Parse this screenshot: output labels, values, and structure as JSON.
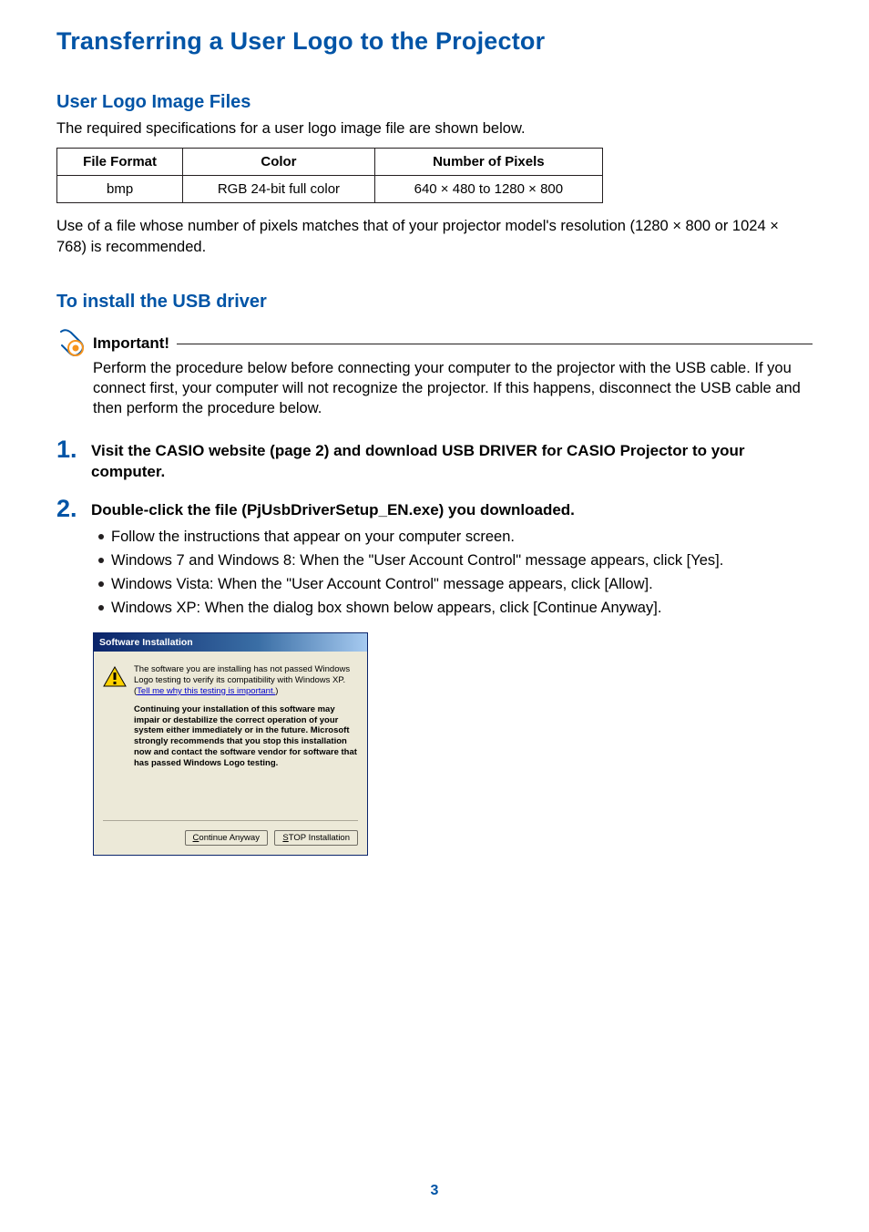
{
  "page": {
    "title": "Transferring a User Logo to the Projector",
    "number": "3"
  },
  "section1": {
    "title": "User Logo Image Files",
    "intro": "The required specifications for a user logo image file are shown below.",
    "table": {
      "headers": [
        "File Format",
        "Color",
        "Number of Pixels"
      ],
      "row": [
        "bmp",
        "RGB 24-bit full color",
        "640 × 480 to 1280 × 800"
      ]
    },
    "note": "Use of a file whose number of pixels matches that of your projector model's resolution (1280 × 800 or 1024 × 768) is recommended."
  },
  "section2": {
    "title": "To install the USB driver",
    "important": {
      "label": "Important!",
      "text": "Perform the procedure below before connecting your computer to the projector with the USB cable. If you connect first, your computer will not recognize the projector. If this happens, disconnect the USB cable and then perform the procedure below."
    },
    "steps": [
      {
        "num": "1.",
        "heading": "Visit the CASIO website (page 2) and download USB DRIVER for CASIO Projector to your computer."
      },
      {
        "num": "2.",
        "heading": "Double-click the file (PjUsbDriverSetup_EN.exe) you downloaded.",
        "bullets": [
          "Follow the instructions that appear on your computer screen.",
          "Windows 7 and Windows 8: When the \"User Account Control\" message appears, click [Yes].",
          "Windows Vista: When the \"User Account Control\" message appears, click [Allow].",
          "Windows XP: When the dialog box shown below appears, click [Continue Anyway]."
        ]
      }
    ]
  },
  "dialog": {
    "title": "Software Installation",
    "line1": "The software you are installing has not passed Windows Logo testing to verify its compatibility with Windows XP. (",
    "link": "Tell me why this testing is important.",
    "line1_end": ")",
    "bold": "Continuing your installation of this software may impair or destabilize the correct operation of your system either immediately or in the future. Microsoft strongly recommends that you stop this installation now and contact the software vendor for software that has passed Windows Logo testing.",
    "btn_continue": "Continue Anyway",
    "btn_stop_u": "S",
    "btn_stop_rest": "TOP Installation"
  }
}
